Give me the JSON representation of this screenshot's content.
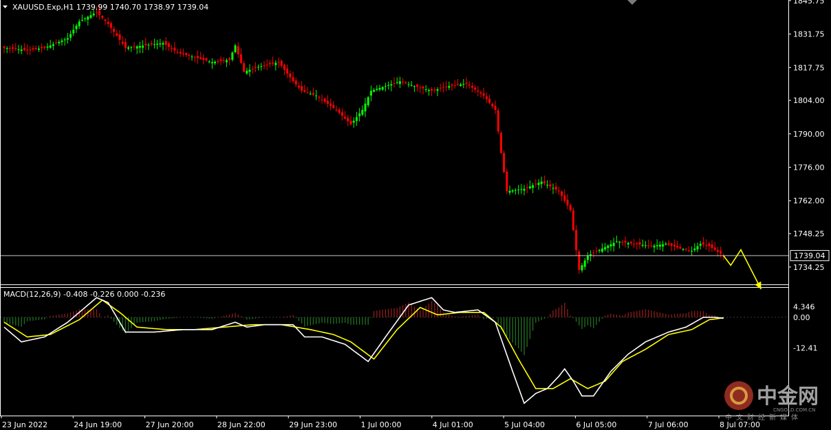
{
  "symbol_header": "XAUUSD.Exp,H1  1739.99 1740.70 1738.97 1739.04",
  "macd_header": "MACD(12,26,9) -0.408 -0.226 0.000 -0.236",
  "watermark": {
    "logo_text": "中金网",
    "sub_text": "中文财经新媒体",
    "url_text": "CNGOLD.COM.CN"
  },
  "colors": {
    "background": "#000000",
    "bull_candle": "#00ff00",
    "bear_candle": "#ff0000",
    "grid_frame": "#ffffff",
    "macd_hist_pos": "#8b1a1a",
    "macd_hist_neg": "#1f6b1f",
    "macd_line": "#ffffff",
    "signal_line": "#ffff00",
    "arrow": "#ffff00"
  },
  "chart_data": [
    {
      "type": "candlestick",
      "timeframe": "H1",
      "current_price": 1739.04,
      "current_price_label": "1739.04",
      "ylim": [
        1727,
        1846
      ],
      "y_ticks": [
        "1845.75",
        "1831.75",
        "1817.75",
        "1804.00",
        "1790.00",
        "1776.00",
        "1762.00",
        "1748.25",
        "1734.25"
      ],
      "y_tick_values": [
        1845.75,
        1831.75,
        1817.75,
        1804.0,
        1790.0,
        1776.0,
        1762.0,
        1748.25,
        1734.25
      ],
      "x_ticks": [
        "23 Jun 2022",
        "24 Jun 19:00",
        "27 Jun 20:00",
        "28 Jun 22:00",
        "29 Jun 23:00",
        "1 Jul 00:00",
        "4 Jul 01:00",
        "5 Jul 04:00",
        "6 Jul 05:00",
        "7 Jul 06:00",
        "8 Jul 07:00"
      ],
      "bar_count": 250,
      "close_anchors": [
        [
          0,
          1826
        ],
        [
          8,
          1825
        ],
        [
          14,
          1826
        ],
        [
          22,
          1830
        ],
        [
          26,
          1837
        ],
        [
          32,
          1841
        ],
        [
          36,
          1836
        ],
        [
          42,
          1826
        ],
        [
          55,
          1828
        ],
        [
          60,
          1824
        ],
        [
          66,
          1822
        ],
        [
          72,
          1820
        ],
        [
          78,
          1821
        ],
        [
          80,
          1827
        ],
        [
          83,
          1816
        ],
        [
          88,
          1818
        ],
        [
          95,
          1820
        ],
        [
          100,
          1812
        ],
        [
          103,
          1808
        ],
        [
          108,
          1806
        ],
        [
          115,
          1800
        ],
        [
          120,
          1794
        ],
        [
          124,
          1800
        ],
        [
          127,
          1808
        ],
        [
          132,
          1810
        ],
        [
          137,
          1812
        ],
        [
          142,
          1810
        ],
        [
          148,
          1808
        ],
        [
          154,
          1810
        ],
        [
          160,
          1811
        ],
        [
          166,
          1806
        ],
        [
          170,
          1800
        ],
        [
          172,
          1782
        ],
        [
          174,
          1766
        ],
        [
          180,
          1767
        ],
        [
          186,
          1770
        ],
        [
          192,
          1766
        ],
        [
          196,
          1758
        ],
        [
          199,
          1733
        ],
        [
          202,
          1739
        ],
        [
          207,
          1742
        ],
        [
          212,
          1745
        ],
        [
          218,
          1744
        ],
        [
          224,
          1743
        ],
        [
          229,
          1744
        ],
        [
          234,
          1742
        ],
        [
          238,
          1741
        ],
        [
          241,
          1744
        ],
        [
          244,
          1743
        ],
        [
          249,
          1739.04
        ]
      ],
      "projected_path": [
        [
          249,
          1739
        ],
        [
          251.5,
          1735
        ],
        [
          255,
          1741.5
        ],
        [
          262,
          1725
        ]
      ]
    },
    {
      "type": "macd",
      "params": "12,26,9",
      "ylim": [
        -40,
        12
      ],
      "y_ticks": [
        "4.346",
        "0.00",
        "-12.41"
      ],
      "y_tick_values": [
        4.346,
        0.0,
        -12.41
      ],
      "macd_anchors": [
        [
          0,
          -4
        ],
        [
          6,
          -10
        ],
        [
          14,
          -8
        ],
        [
          22,
          -2
        ],
        [
          32,
          8
        ],
        [
          36,
          6
        ],
        [
          42,
          -6
        ],
        [
          52,
          -6
        ],
        [
          62,
          -5
        ],
        [
          72,
          -5
        ],
        [
          80,
          -2
        ],
        [
          84,
          -4
        ],
        [
          90,
          -3
        ],
        [
          100,
          -3
        ],
        [
          104,
          -8
        ],
        [
          110,
          -8
        ],
        [
          118,
          -11
        ],
        [
          126,
          -18
        ],
        [
          132,
          -8
        ],
        [
          140,
          5
        ],
        [
          148,
          8
        ],
        [
          152,
          3
        ],
        [
          156,
          2
        ],
        [
          164,
          3
        ],
        [
          170,
          -2
        ],
        [
          176,
          -22
        ],
        [
          180,
          -35
        ],
        [
          184,
          -31
        ],
        [
          188,
          -29
        ],
        [
          192,
          -24
        ],
        [
          194,
          -21
        ],
        [
          197,
          -26
        ],
        [
          200,
          -32
        ],
        [
          204,
          -32
        ],
        [
          210,
          -22
        ],
        [
          216,
          -15
        ],
        [
          222,
          -10
        ],
        [
          230,
          -6
        ],
        [
          236,
          -4
        ],
        [
          242,
          0
        ],
        [
          246,
          0
        ],
        [
          249,
          -0.4
        ]
      ],
      "signal_anchors": [
        [
          0,
          -2
        ],
        [
          8,
          -8
        ],
        [
          16,
          -7
        ],
        [
          26,
          -1
        ],
        [
          34,
          7
        ],
        [
          40,
          2
        ],
        [
          46,
          -4
        ],
        [
          56,
          -5
        ],
        [
          66,
          -5
        ],
        [
          76,
          -4
        ],
        [
          86,
          -3
        ],
        [
          96,
          -3
        ],
        [
          106,
          -5
        ],
        [
          114,
          -7
        ],
        [
          120,
          -10
        ],
        [
          128,
          -17
        ],
        [
          136,
          -5
        ],
        [
          144,
          4
        ],
        [
          150,
          1
        ],
        [
          158,
          2
        ],
        [
          166,
          2
        ],
        [
          172,
          -4
        ],
        [
          178,
          -17
        ],
        [
          184,
          -29
        ],
        [
          190,
          -29
        ],
        [
          196,
          -25
        ],
        [
          202,
          -29
        ],
        [
          208,
          -26
        ],
        [
          214,
          -18
        ],
        [
          222,
          -13
        ],
        [
          230,
          -7
        ],
        [
          238,
          -5
        ],
        [
          244,
          -1
        ],
        [
          249,
          -0.2
        ]
      ]
    }
  ]
}
